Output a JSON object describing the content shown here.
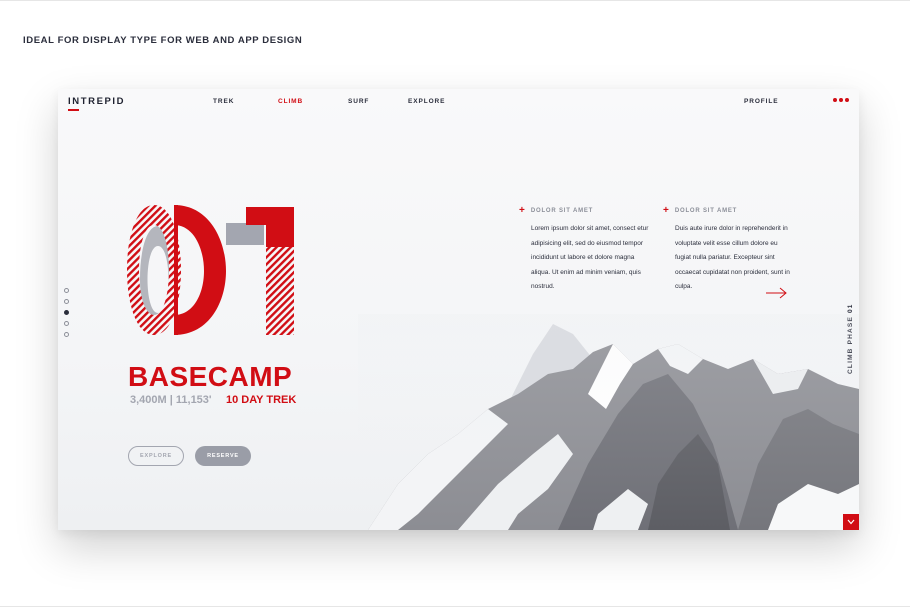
{
  "caption": "IDEAL FOR DISPLAY TYPE FOR WEB AND APP DESIGN",
  "brand": "INTREPID",
  "nav": {
    "items": [
      "TREK",
      "CLIMB",
      "SURF",
      "EXPLORE"
    ],
    "active": "CLIMB",
    "profile": "PROFILE"
  },
  "icons": {
    "menu": "more-dots-icon",
    "arrow": "arrow-right-icon",
    "corner": "chevron-down-icon"
  },
  "colors": {
    "accent": "#d10d14",
    "dark": "#2b2e3c",
    "grey": "#a3a6b0"
  },
  "slider": {
    "count": 5,
    "active_index": 2
  },
  "hero": {
    "number": "01",
    "title": "BASECAMP",
    "elevation": "3,400M | 11,153'",
    "duration": "10 DAY TREK"
  },
  "buttons": {
    "explore": "EXPLORE",
    "reserve": "RESERVE"
  },
  "info": [
    {
      "title": "DOLOR SIT AMET",
      "body": "Lorem ipsum dolor sit amet, consect etur adipisicing elit, sed do eiusmod tempor incididunt ut labore et dolore magna aliqua. Ut enim ad minim veniam, quis nostrud."
    },
    {
      "title": "DOLOR SIT AMET",
      "body": "Duis aute irure dolor in reprehenderit in voluptate velit esse cillum dolore eu fugiat nulla pariatur. Excepteur sint occaecat cupidatat non proident, sunt in culpa."
    }
  ],
  "phase_label": "CLIMB PHASE 01"
}
